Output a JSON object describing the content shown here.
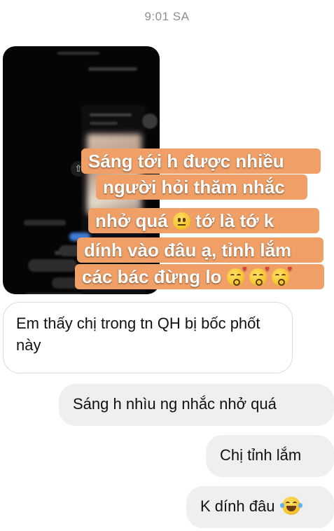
{
  "header": {
    "timestamp": "9:01 SA"
  },
  "shared_image": {
    "caption_lines": [
      "Sáng tới h được nhiều",
      "người hỏi thăm nhắc",
      "nhở quá",
      "tớ là tớ k",
      "dính vào đâu ạ, tỉnh lắm",
      "các bác đừng lo"
    ],
    "caption_bg": "#f0a066",
    "icons": [
      "neutral-face-emoji",
      "kiss-face-emoji",
      "share-icon"
    ]
  },
  "messages": [
    {
      "direction": "incoming",
      "text": "Em thấy chị trong tn QH bị bốc phốt này"
    },
    {
      "direction": "outgoing",
      "text": "Sáng h nhìu ng nhắc nhở quá"
    },
    {
      "direction": "outgoing",
      "text": "Chị tỉnh lắm"
    },
    {
      "direction": "outgoing",
      "text": "K dính đâu",
      "emoji": "laughing-tears-emoji"
    }
  ],
  "colors": {
    "incoming_bg": "#ffffff",
    "outgoing_bg": "#efefef",
    "timestamp": "#8e8e8e"
  }
}
